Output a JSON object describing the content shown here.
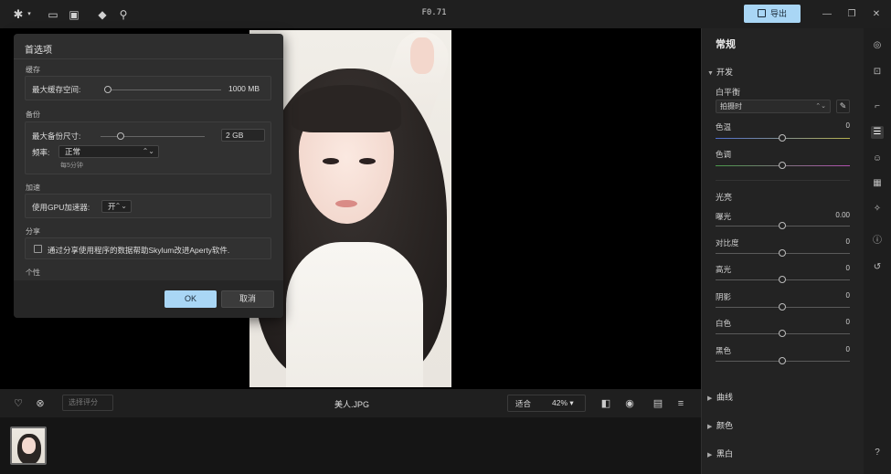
{
  "topbar": {
    "title": "F0.71",
    "export_label": "导出",
    "icons": [
      "app-menu-icon",
      "folder-icon",
      "image-library-icon",
      "eraser-icon",
      "search-icon"
    ]
  },
  "dialog": {
    "title": "首选项",
    "cache_section": "缓存",
    "cache_max_label": "最大缓存空间:",
    "cache_max_value": "1000 MB",
    "backup_section": "备份",
    "backup_max_label": "最大备份尺寸:",
    "backup_max_value": "2 GB",
    "freq_label": "频率:",
    "freq_value": "正常",
    "freq_note": "每5分钟",
    "accel_section": "加速",
    "gpu_label": "使用GPU加速器:",
    "gpu_value": "开",
    "share_section": "分享",
    "share_text": "通过分享使用程序的数据帮助Skylum改进Aperty软件.",
    "cut_section": "个性",
    "ok_label": "OK",
    "cancel_label": "取消"
  },
  "bottombar": {
    "rating_placeholder": "选择评分",
    "filename": "美人.JPG",
    "zoom_fit": "适合",
    "zoom_pct": "42% ▾"
  },
  "rightpanel": {
    "title": "常规",
    "develop_section": "开发",
    "wb_label": "白平衡",
    "wb_value": "拍摄时",
    "temp_label": "色温",
    "temp_value": "0",
    "tint_label": "色调",
    "light_section": "光亮",
    "exposure_label": "曝光",
    "exposure_value": "0.00",
    "contrast_label": "对比度",
    "contrast_value": "0",
    "highlights_label": "高光",
    "highlights_value": "0",
    "shadows_label": "阴影",
    "shadows_value": "0",
    "whites_label": "白色",
    "whites_value": "0",
    "blacks_label": "黑色",
    "blacks_value": "0",
    "curves_section": "曲线",
    "color_section": "颜色",
    "bw_section": "黑白"
  }
}
